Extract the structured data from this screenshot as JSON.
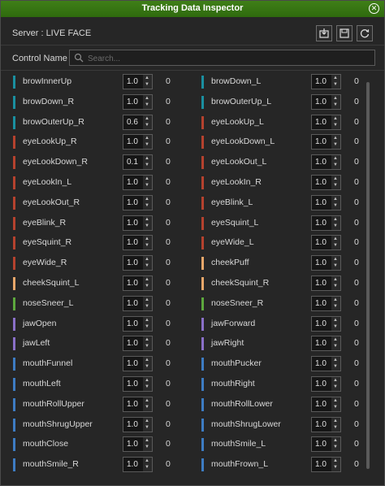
{
  "title": "Tracking Data Inspector",
  "server_label": "Server : LIVE FACE",
  "control_label": "Control Name :",
  "search_placeholder": "Search...",
  "colors": {
    "teal": "#1a8fa0",
    "red": "#b5422e",
    "peach": "#e8a76a",
    "green": "#5da83d",
    "purple": "#8a70c8",
    "blue": "#3d7cc3"
  },
  "left": [
    {
      "name": "browInnerUp",
      "value": "1.0",
      "reading": "0",
      "color": "teal"
    },
    {
      "name": "browDown_R",
      "value": "1.0",
      "reading": "0",
      "color": "teal"
    },
    {
      "name": "browOuterUp_R",
      "value": "0.6",
      "reading": "0",
      "color": "teal"
    },
    {
      "name": "eyeLookUp_R",
      "value": "1.0",
      "reading": "0",
      "color": "red"
    },
    {
      "name": "eyeLookDown_R",
      "value": "0.1",
      "reading": "0",
      "color": "red"
    },
    {
      "name": "eyeLookIn_L",
      "value": "1.0",
      "reading": "0",
      "color": "red"
    },
    {
      "name": "eyeLookOut_R",
      "value": "1.0",
      "reading": "0",
      "color": "red"
    },
    {
      "name": "eyeBlink_R",
      "value": "1.0",
      "reading": "0",
      "color": "red"
    },
    {
      "name": "eyeSquint_R",
      "value": "1.0",
      "reading": "0",
      "color": "red"
    },
    {
      "name": "eyeWide_R",
      "value": "1.0",
      "reading": "0",
      "color": "red"
    },
    {
      "name": "cheekSquint_L",
      "value": "1.0",
      "reading": "0",
      "color": "peach"
    },
    {
      "name": "noseSneer_L",
      "value": "1.0",
      "reading": "0",
      "color": "green"
    },
    {
      "name": "jawOpen",
      "value": "1.0",
      "reading": "0",
      "color": "purple"
    },
    {
      "name": "jawLeft",
      "value": "1.0",
      "reading": "0",
      "color": "purple"
    },
    {
      "name": "mouthFunnel",
      "value": "1.0",
      "reading": "0",
      "color": "blue"
    },
    {
      "name": "mouthLeft",
      "value": "1.0",
      "reading": "0",
      "color": "blue"
    },
    {
      "name": "mouthRollUpper",
      "value": "1.0",
      "reading": "0",
      "color": "blue"
    },
    {
      "name": "mouthShrugUpper",
      "value": "1.0",
      "reading": "0",
      "color": "blue"
    },
    {
      "name": "mouthClose",
      "value": "1.0",
      "reading": "0",
      "color": "blue"
    },
    {
      "name": "mouthSmile_R",
      "value": "1.0",
      "reading": "0",
      "color": "blue"
    }
  ],
  "right": [
    {
      "name": "browDown_L",
      "value": "1.0",
      "reading": "0",
      "color": "teal"
    },
    {
      "name": "browOuterUp_L",
      "value": "1.0",
      "reading": "0",
      "color": "teal"
    },
    {
      "name": "eyeLookUp_L",
      "value": "1.0",
      "reading": "0",
      "color": "red"
    },
    {
      "name": "eyeLookDown_L",
      "value": "1.0",
      "reading": "0",
      "color": "red"
    },
    {
      "name": "eyeLookOut_L",
      "value": "1.0",
      "reading": "0",
      "color": "red"
    },
    {
      "name": "eyeLookIn_R",
      "value": "1.0",
      "reading": "0",
      "color": "red"
    },
    {
      "name": "eyeBlink_L",
      "value": "1.0",
      "reading": "0",
      "color": "red"
    },
    {
      "name": "eyeSquint_L",
      "value": "1.0",
      "reading": "0",
      "color": "red"
    },
    {
      "name": "eyeWide_L",
      "value": "1.0",
      "reading": "0",
      "color": "red"
    },
    {
      "name": "cheekPuff",
      "value": "1.0",
      "reading": "0",
      "color": "peach"
    },
    {
      "name": "cheekSquint_R",
      "value": "1.0",
      "reading": "0",
      "color": "peach"
    },
    {
      "name": "noseSneer_R",
      "value": "1.0",
      "reading": "0",
      "color": "green"
    },
    {
      "name": "jawForward",
      "value": "1.0",
      "reading": "0",
      "color": "purple"
    },
    {
      "name": "jawRight",
      "value": "1.0",
      "reading": "0",
      "color": "purple"
    },
    {
      "name": "mouthPucker",
      "value": "1.0",
      "reading": "0",
      "color": "blue"
    },
    {
      "name": "mouthRight",
      "value": "1.0",
      "reading": "0",
      "color": "blue"
    },
    {
      "name": "mouthRollLower",
      "value": "1.0",
      "reading": "0",
      "color": "blue"
    },
    {
      "name": "mouthShrugLower",
      "value": "1.0",
      "reading": "0",
      "color": "blue"
    },
    {
      "name": "mouthSmile_L",
      "value": "1.0",
      "reading": "0",
      "color": "blue"
    },
    {
      "name": "mouthFrown_L",
      "value": "1.0",
      "reading": "0",
      "color": "blue"
    }
  ],
  "icons": {
    "close": "close-icon",
    "export": "export-icon",
    "save": "save-icon",
    "refresh": "refresh-icon",
    "search": "search-icon"
  }
}
